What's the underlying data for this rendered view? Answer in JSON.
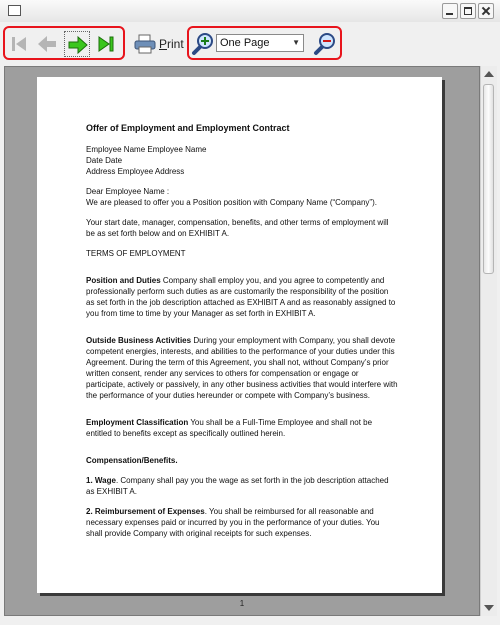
{
  "toolbar": {
    "print_label_prefix": "P",
    "print_label_rest": "rint",
    "zoom_value": "One Page"
  },
  "document": {
    "title": "Offer of Employment and Employment Contract",
    "header_lines": [
      "Employee Name Employee Name",
      "Date Date",
      "Address Employee Address"
    ],
    "greeting": "Dear Employee Name :",
    "intro": "We are pleased to offer you a Position position with Company Name (“Company”).",
    "start_para": "Your start date, manager, compensation, benefits, and other terms of employment will be as set forth below and on EXHIBIT A.",
    "terms_heading": "TERMS OF EMPLOYMENT",
    "position_heading": "Position and Duties",
    "position_text": "Company shall employ you, and you agree to competently and professionally perform such duties as are customarily the responsibility of the position as set forth in the job description attached as EXHIBIT A and as reasonably assigned to you from time to time by your Manager as set forth in EXHIBIT A.",
    "outside_heading": "Outside Business Activities",
    "outside_text": "During your employment with Company, you shall devote competent energies, interests, and abilities to the performance of your duties under this Agreement. During the term of this Agreement, you shall not, without Company’s prior written consent, render any services to others for compensation or engage or participate, actively or passively, in any other business activities that would interfere with the performance of your duties hereunder or compete with Company’s business.",
    "classification_heading": "Employment Classification",
    "classification_text": "You shall be a Full-Time Employee and shall not be entitled to benefits except as specifically outlined herein.",
    "comp_heading": "Compensation/Benefits.",
    "wage_heading": "1. Wage",
    "wage_text": ". Company shall pay you the wage as set forth in the job description attached as EXHIBIT A.",
    "reimb_heading": "2. Reimbursement of Expenses",
    "reimb_text": ". You shall be reimbursed for all reasonable and necessary expenses paid or incurred by you in the performance of your duties. You shall provide Company with original receipts for such expenses.",
    "page_number": "1"
  }
}
